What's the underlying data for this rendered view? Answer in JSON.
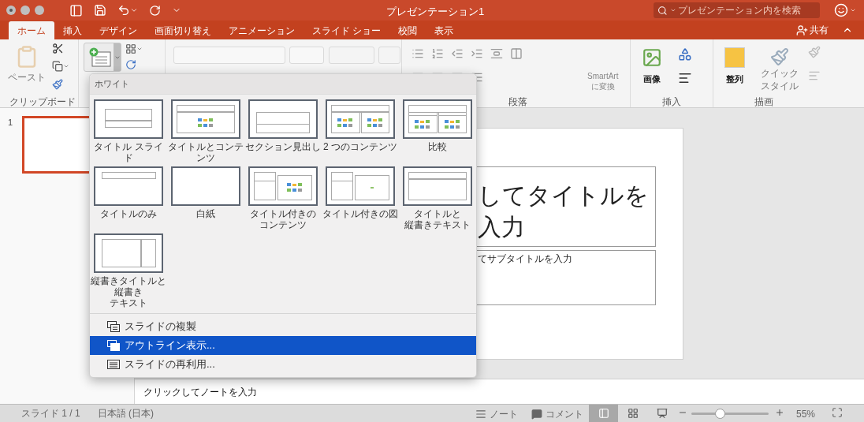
{
  "window": {
    "title": "プレゼンテーション1"
  },
  "search": {
    "placeholder": "プレゼンテーション内を検索"
  },
  "tabs": [
    {
      "label": "ホーム",
      "selected": true
    },
    {
      "label": "挿入",
      "selected": false
    },
    {
      "label": "デザイン",
      "selected": false
    },
    {
      "label": "画面切り替え",
      "selected": false
    },
    {
      "label": "アニメーション",
      "selected": false
    },
    {
      "label": "スライド ショー",
      "selected": false
    },
    {
      "label": "校閲",
      "selected": false
    },
    {
      "label": "表示",
      "selected": false
    }
  ],
  "share": "共有",
  "ribbon": {
    "paste": "ペースト",
    "clipboard_group": "クリップボード",
    "paragraph_group": "段落",
    "smartart": [
      "SmartArt",
      "に変換"
    ],
    "insert_group": "挿入",
    "picture": "画像",
    "arrange": "整列",
    "quick_style": [
      "クイック",
      "スタイル"
    ],
    "drawing_group": "描画"
  },
  "thumbnails": [
    {
      "number": "1",
      "selected": true
    }
  ],
  "slide": {
    "title": [
      "してタイトルを",
      "入力"
    ],
    "subtitle": "てサブタイトルを入力"
  },
  "notes": {
    "placeholder": "クリックしてノートを入力"
  },
  "layout_menu": {
    "section": "ホワイト",
    "layouts": [
      {
        "kind": "title",
        "lines": [
          "タイトル スライド"
        ]
      },
      {
        "kind": "title_content",
        "lines": [
          "タイトルとコンテンツ"
        ]
      },
      {
        "kind": "section",
        "lines": [
          "セクション見出し"
        ]
      },
      {
        "kind": "two_content",
        "lines": [
          "2 つのコンテンツ"
        ]
      },
      {
        "kind": "comparison",
        "lines": [
          "比較"
        ]
      },
      {
        "kind": "title_only",
        "lines": [
          "タイトルのみ"
        ]
      },
      {
        "kind": "blank",
        "lines": [
          "白紙"
        ]
      },
      {
        "kind": "content_caption",
        "lines": [
          "タイトル付きの",
          "コンテンツ"
        ]
      },
      {
        "kind": "picture_caption",
        "lines": [
          "タイトル付きの図"
        ]
      },
      {
        "kind": "vertical_text",
        "lines": [
          "タイトルと",
          "縦書きテキスト"
        ]
      },
      {
        "kind": "vertical_title",
        "lines": [
          "縦書きタイトルと縦書き",
          "テキスト"
        ]
      }
    ],
    "items": [
      {
        "label": "スライドの複製",
        "selected": false
      },
      {
        "label": "アウトライン表示...",
        "selected": true
      },
      {
        "label": "スライドの再利用...",
        "selected": false
      }
    ]
  },
  "status_bar": {
    "slide": "スライド 1 / 1",
    "language": "日本語 (日本)",
    "notes": "ノート",
    "comments": "コメント",
    "views": [
      {
        "kind": "normal",
        "selected": true
      },
      {
        "kind": "sorter",
        "selected": false
      },
      {
        "kind": "show",
        "selected": false
      }
    ],
    "zoom": {
      "level": 0.37,
      "reading": "55%"
    }
  }
}
